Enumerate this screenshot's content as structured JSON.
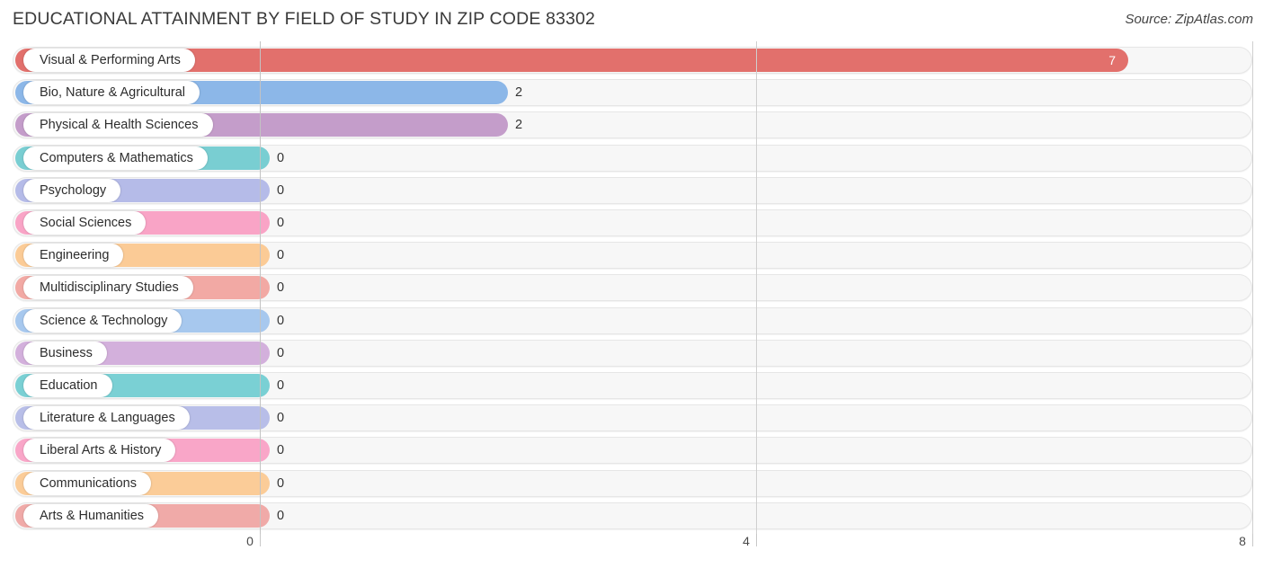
{
  "header": {
    "title": "EDUCATIONAL ATTAINMENT BY FIELD OF STUDY IN ZIP CODE 83302",
    "source": "Source: ZipAtlas.com"
  },
  "chart_data": {
    "type": "bar",
    "orientation": "horizontal",
    "title": "EDUCATIONAL ATTAINMENT BY FIELD OF STUDY IN ZIP CODE 83302",
    "xlabel": "",
    "ylabel": "",
    "xlim": [
      0,
      8
    ],
    "grid": true,
    "legend": "none",
    "xticks": [
      "0",
      "4",
      "8"
    ],
    "xtick_values": [
      0,
      4,
      8
    ],
    "categories": [
      "Visual & Performing Arts",
      "Bio, Nature & Agricultural",
      "Physical & Health Sciences",
      "Computers & Mathematics",
      "Psychology",
      "Social Sciences",
      "Engineering",
      "Multidisciplinary Studies",
      "Science & Technology",
      "Business",
      "Education",
      "Literature & Languages",
      "Liberal Arts & History",
      "Communications",
      "Arts & Humanities"
    ],
    "values": [
      7,
      2,
      2,
      0,
      0,
      0,
      0,
      0,
      0,
      0,
      0,
      0,
      0,
      0,
      0
    ],
    "value_labels": [
      "7",
      "2",
      "2",
      "0",
      "0",
      "0",
      "0",
      "0",
      "0",
      "0",
      "0",
      "0",
      "0",
      "0",
      "0"
    ],
    "colors": [
      "#e2706c",
      "#8cb7e8",
      "#c49dca",
      "#79ced2",
      "#b5bbe8",
      "#f9a4c6",
      "#fbcb96",
      "#f2a9a4",
      "#a7c8ee",
      "#d3b0dc",
      "#7ad0d4",
      "#b8bee8",
      "#f9a6c8",
      "#fbcc98",
      "#f0aaa8"
    ]
  }
}
